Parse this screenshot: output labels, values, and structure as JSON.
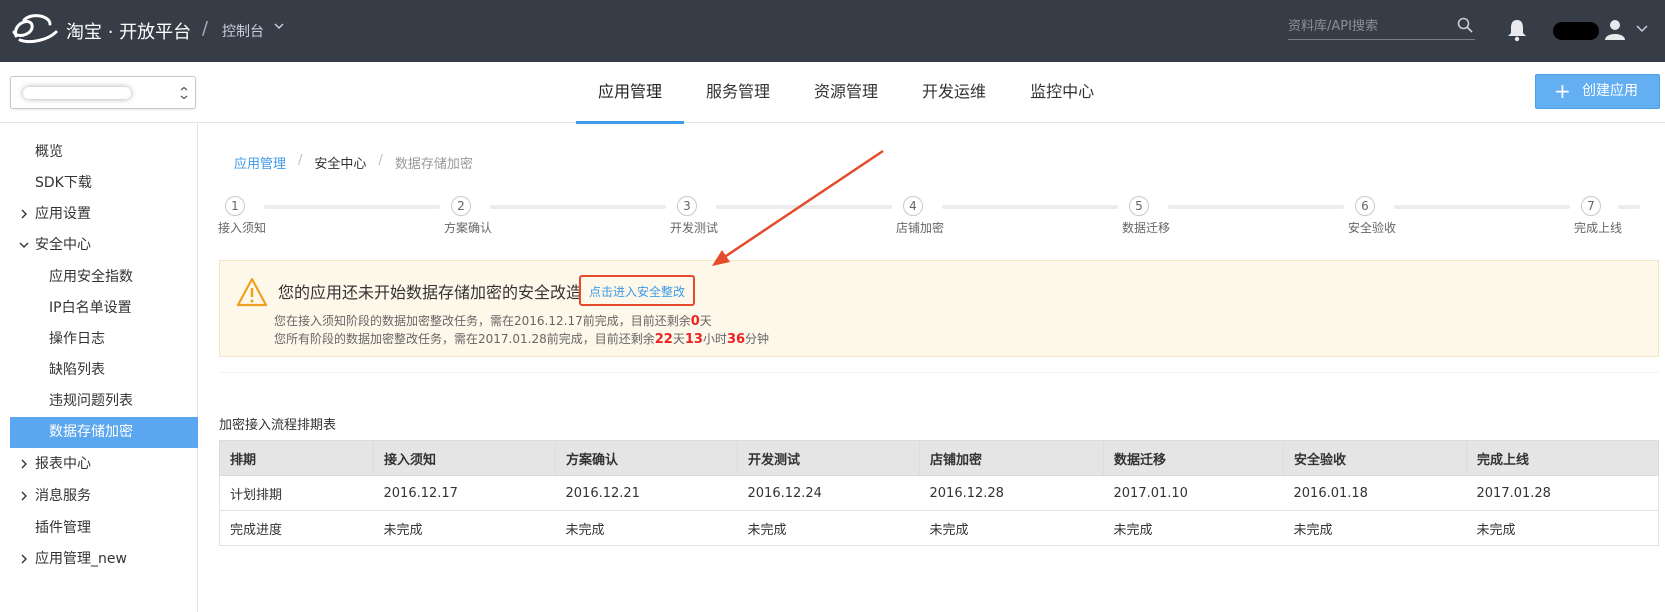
{
  "header": {
    "brand": "淘宝 · 开放平台",
    "separator": "/",
    "console_label": "控制台",
    "search_placeholder": "资料库/API搜索"
  },
  "subnav": {
    "tabs": [
      {
        "label": "应用管理",
        "active": true
      },
      {
        "label": "服务管理",
        "active": false
      },
      {
        "label": "资源管理",
        "active": false
      },
      {
        "label": "开发运维",
        "active": false
      },
      {
        "label": "监控中心",
        "active": false
      }
    ],
    "create_button": "创建应用",
    "create_plus": "+"
  },
  "sidebar": {
    "items": [
      {
        "label": "概览"
      },
      {
        "label": "SDK下载"
      },
      {
        "label": "应用设置"
      },
      {
        "label": "安全中心"
      },
      {
        "label": "应用安全指数"
      },
      {
        "label": "IP白名单设置"
      },
      {
        "label": "操作日志"
      },
      {
        "label": "缺陷列表"
      },
      {
        "label": "违规问题列表"
      },
      {
        "label": "数据存储加密"
      },
      {
        "label": "报表中心"
      },
      {
        "label": "消息服务"
      },
      {
        "label": "插件管理"
      },
      {
        "label": "应用管理_new"
      }
    ]
  },
  "breadcrumb": {
    "root": "应用管理",
    "sep": "/",
    "middle": "安全中心",
    "current": "数据存储加密"
  },
  "steps": [
    {
      "num": "1",
      "label": "接入须知"
    },
    {
      "num": "2",
      "label": "方案确认"
    },
    {
      "num": "3",
      "label": "开发测试"
    },
    {
      "num": "4",
      "label": "店铺加密"
    },
    {
      "num": "5",
      "label": "数据迁移"
    },
    {
      "num": "6",
      "label": "安全验收"
    },
    {
      "num": "7",
      "label": "完成上线"
    }
  ],
  "alert": {
    "title": "您的应用还未开始数据存储加密的安全改造",
    "link": "点击进入安全整改",
    "line1_prefix": "您在接入须知阶段的数据加密整改任务，需在2016.12.17前完成，目前还剩余",
    "line1_days": "0",
    "line1_suffix": "天",
    "line2_prefix": "您所有阶段的数据加密整改任务，需在2017.01.28前完成，目前还剩余",
    "line2_days": "22",
    "line2_day_unit": "天",
    "line2_hours": "13",
    "line2_hour_unit": "小时",
    "line2_minutes": "36",
    "line2_minute_unit": "分钟"
  },
  "schedule": {
    "title": "加密接入流程排期表",
    "headers": [
      "排期",
      "接入须知",
      "方案确认",
      "开发测试",
      "店铺加密",
      "数据迁移",
      "安全验收",
      "完成上线"
    ],
    "rows": [
      [
        "计划排期",
        "2016.12.17",
        "2016.12.21",
        "2016.12.24",
        "2016.12.28",
        "2017.01.10",
        "2016.01.18",
        "2017.01.28"
      ],
      [
        "完成进度",
        "未完成",
        "未完成",
        "未完成",
        "未完成",
        "未完成",
        "未完成",
        "未完成"
      ]
    ]
  },
  "colors": {
    "topbar": "#373d46",
    "accent": "#3d9be9",
    "sidebar_active": "#5aa6ef",
    "alert_bg": "#fdf8e9",
    "highlight_red": "#e34b2a"
  }
}
